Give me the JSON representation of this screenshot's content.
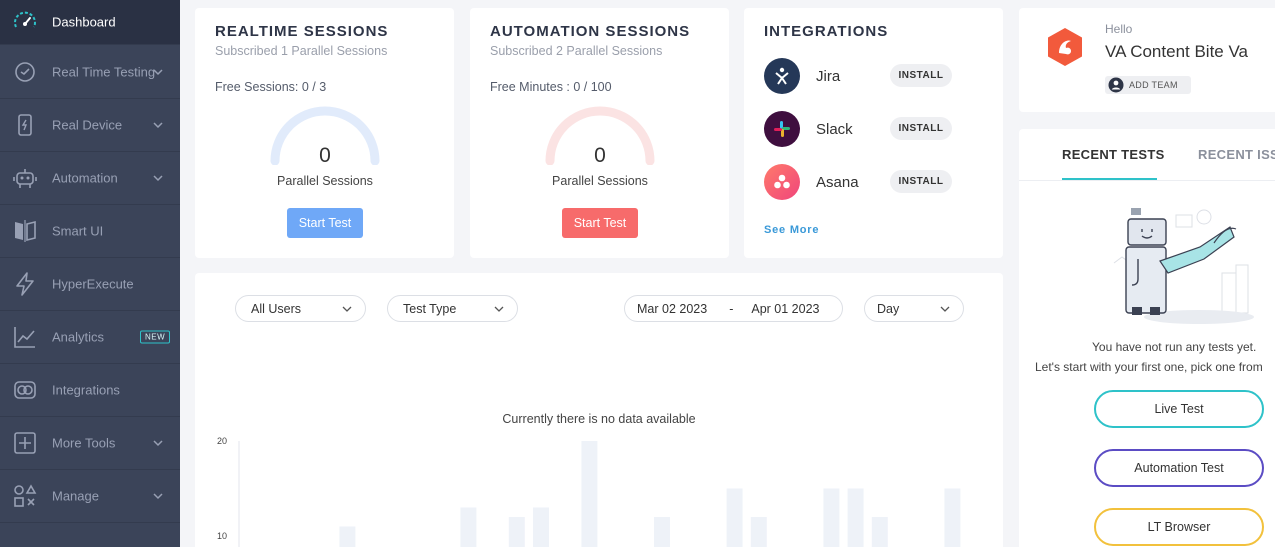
{
  "sidebar": {
    "items": [
      {
        "label": "Dashboard",
        "icon": "gauge-icon"
      },
      {
        "label": "Real Time Testing",
        "icon": "clock-icon"
      },
      {
        "label": "Real Device",
        "icon": "mobile-device-icon"
      },
      {
        "label": "Automation",
        "icon": "robot-icon"
      },
      {
        "label": "Smart UI",
        "icon": "compare-icon"
      },
      {
        "label": "HyperExecute",
        "icon": "lightning-icon"
      },
      {
        "label": "Analytics",
        "icon": "chart-line-icon",
        "badge": "NEW"
      },
      {
        "label": "Integrations",
        "icon": "integrations-icon"
      },
      {
        "label": "More Tools",
        "icon": "plus-square-icon"
      },
      {
        "label": "Manage",
        "icon": "shapes-icon"
      }
    ]
  },
  "realtime": {
    "title": "REALTIME SESSIONS",
    "subtitle": "Subscribed 1 Parallel Sessions",
    "free": "Free Sessions: 0 / 3",
    "value": "0",
    "value_label": "Parallel Sessions",
    "button": "Start Test",
    "color": "#6fa8f7"
  },
  "automation": {
    "title": "AUTOMATION SESSIONS",
    "subtitle": "Subscribed 2 Parallel Sessions",
    "free": "Free Minutes : 0 / 100",
    "value": "0",
    "value_label": "Parallel Sessions",
    "button": "Start Test",
    "color": "#f76b6b"
  },
  "integrations": {
    "title": "INTEGRATIONS",
    "items": [
      {
        "name": "Jira",
        "action": "INSTALL",
        "icon": "jira-icon"
      },
      {
        "name": "Slack",
        "action": "INSTALL",
        "icon": "slack-icon"
      },
      {
        "name": "Asana",
        "action": "INSTALL",
        "icon": "asana-icon"
      }
    ],
    "see_more": "See More"
  },
  "filters": {
    "users": "All Users",
    "test_type": "Test Type",
    "date_from": "Mar 02 2023",
    "date_sep": "-",
    "date_to": "Apr 01 2023",
    "granularity": "Day"
  },
  "chart": {
    "message": "Currently there is no data available",
    "y_ticks": [
      "20",
      "10"
    ]
  },
  "chart_data": {
    "type": "bar",
    "ylim": [
      0,
      20
    ],
    "values": [
      0,
      0,
      11,
      0,
      0,
      0,
      0,
      13,
      0,
      12,
      13,
      0,
      20,
      0,
      0,
      12,
      0,
      0,
      15,
      12,
      0,
      0,
      15,
      15,
      12,
      0,
      0,
      15
    ]
  },
  "user": {
    "greeting": "Hello",
    "name": "VA Content Bite Va",
    "add_team": "ADD TEAM",
    "brand_color": "#f25a3c"
  },
  "recent": {
    "tab_active": "RECENT TESTS",
    "tab_inactive": "RECENT ISSUES",
    "empty_line1": "You have not run any tests yet.",
    "empty_line2": "Let's start with your first one, pick one from",
    "buttons": [
      {
        "label": "Live Test",
        "color": "#2ec2c9"
      },
      {
        "label": "Automation Test",
        "color": "#5b4cc4"
      },
      {
        "label": "LT Browser",
        "color": "#f2c13c"
      }
    ]
  }
}
